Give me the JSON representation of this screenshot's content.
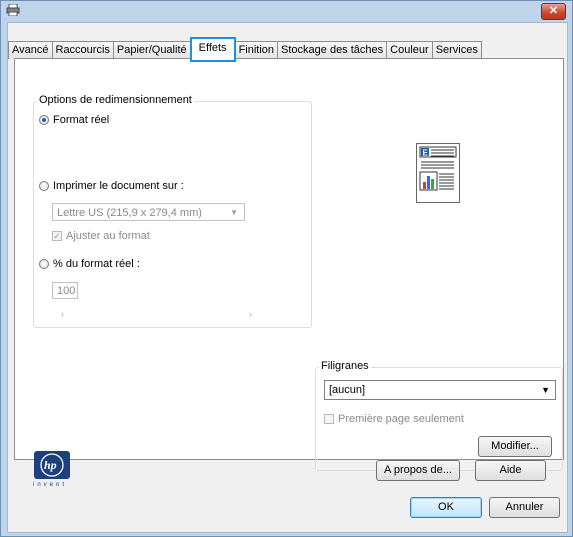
{
  "window": {
    "close_glyph": "✕"
  },
  "tabs": [
    {
      "label": "Avancé"
    },
    {
      "label": "Raccourcis"
    },
    {
      "label": "Papier/Qualité"
    },
    {
      "label": "Effets"
    },
    {
      "label": "Finition"
    },
    {
      "label": "Stockage des tâches"
    },
    {
      "label": "Couleur"
    },
    {
      "label": "Services"
    }
  ],
  "resize": {
    "title": "Options de redimensionnement",
    "actual_size_label": "Format réel",
    "print_on_label": "Imprimer le document sur :",
    "paper_select": "Lettre US (215,9 x 279,4 mm)",
    "fit_label": "Ajuster au format",
    "percent_label": "% du format réel :",
    "percent_value": "100",
    "slider_left": "‹",
    "slider_right": "›"
  },
  "watermarks": {
    "title": "Filigranes",
    "selected": "[aucun]",
    "first_page_label": "Première page seulement",
    "edit_button": "Modifier..."
  },
  "preview": {
    "header_letter": "E"
  },
  "logo": {
    "mark": "hp",
    "tagline": "invent"
  },
  "buttons": {
    "about": "A propos de...",
    "help": "Aide",
    "ok": "OK",
    "cancel": "Annuler"
  },
  "colors": {
    "active_tab_border": "#1f8ee0",
    "window_frame": "#bfd3ea",
    "hp_blue": "#1d3f7b"
  }
}
